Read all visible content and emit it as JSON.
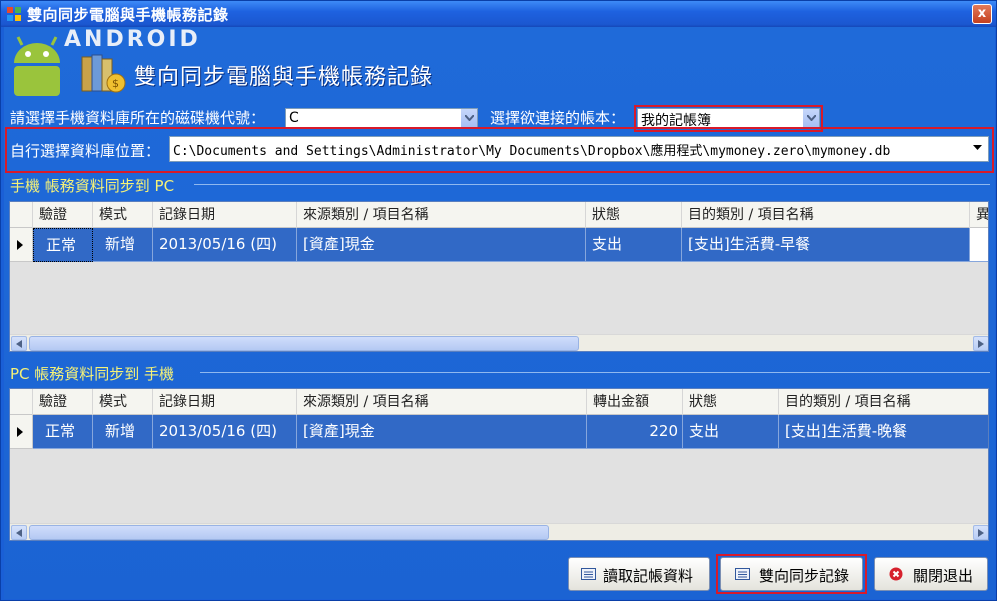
{
  "window": {
    "title": "雙向同步電腦與手機帳務記錄",
    "close_label": "x"
  },
  "banner": {
    "android_word": "ANDROID",
    "heading": "雙向同步電腦與手機帳務記錄"
  },
  "drive": {
    "label": "請選擇手機資料庫所在的磁碟機代號：",
    "value": "C"
  },
  "book": {
    "label": "選擇欲連接的帳本：",
    "value": "我的記帳簿"
  },
  "db_path": {
    "label": "自行選擇資料庫位置：",
    "value": "C:\\Documents and Settings\\Administrator\\My Documents\\Dropbox\\應用程式\\mymoney.zero\\mymoney.db"
  },
  "grid_phone_to_pc": {
    "section_title": "手機 帳務資料同步到 PC",
    "columns": [
      "驗證",
      "模式",
      "記錄日期",
      "來源類別 / 項目名稱",
      "狀態",
      "目的類別 / 項目名稱",
      "異"
    ],
    "rows": [
      {
        "check": "正常",
        "mode": "新增",
        "date": "2013/05/16 (四)",
        "source": "[資產]現金",
        "status": "支出",
        "target": "[支出]生活費-早餐"
      }
    ]
  },
  "grid_pc_to_phone": {
    "section_title": "PC 帳務資料同步到 手機",
    "columns": [
      "驗證",
      "模式",
      "記錄日期",
      "來源類別 / 項目名稱",
      "轉出金額",
      "狀態",
      "目的類別 / 項目名稱"
    ],
    "rows": [
      {
        "check": "正常",
        "mode": "新增",
        "date": "2013/05/16 (四)",
        "source": "[資產]現金",
        "amount": "220",
        "status": "支出",
        "target": "[支出]生活費-晚餐"
      }
    ]
  },
  "buttons": {
    "read": "讀取記帳資料",
    "sync": "雙向同步記錄",
    "exit": "關閉退出"
  },
  "colors": {
    "accent": "#1f6ad9",
    "highlight": "#d81a2a",
    "section": "#f6f277"
  }
}
